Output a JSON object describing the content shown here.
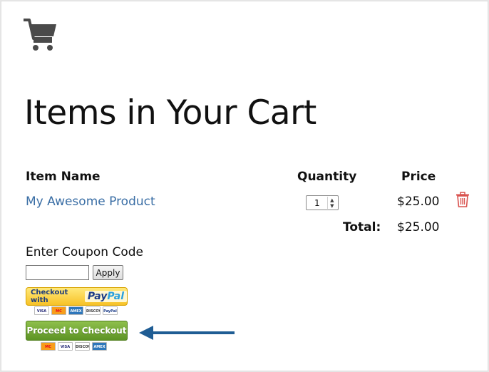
{
  "page": {
    "title": "Items in Your Cart"
  },
  "cart_icon": "shopping-cart-icon",
  "table": {
    "headers": {
      "item_name": "Item Name",
      "quantity": "Quantity",
      "price": "Price"
    },
    "rows": [
      {
        "name": "My Awesome Product",
        "quantity": "1",
        "price": "$25.00"
      }
    ],
    "total_label": "Total:",
    "total_value": "$25.00"
  },
  "coupon": {
    "label": "Enter Coupon Code",
    "input_value": "",
    "apply_label": "Apply"
  },
  "paypal": {
    "label": "Checkout with",
    "logo_pay": "Pay",
    "logo_pal": "Pal",
    "cards": [
      "VISA",
      "MC",
      "AMEX",
      "DISCOVER",
      "PayPal"
    ]
  },
  "checkout": {
    "label": "Proceed to Checkout",
    "cards": [
      "MC",
      "VISA",
      "DISCOVER",
      "AMEX"
    ]
  },
  "colors": {
    "link": "#3a6ea5",
    "delete": "#d9534f",
    "checkout_green": "#6aa22f",
    "paypal_yellow": "#f7c227",
    "arrow_blue": "#1f5d94"
  }
}
